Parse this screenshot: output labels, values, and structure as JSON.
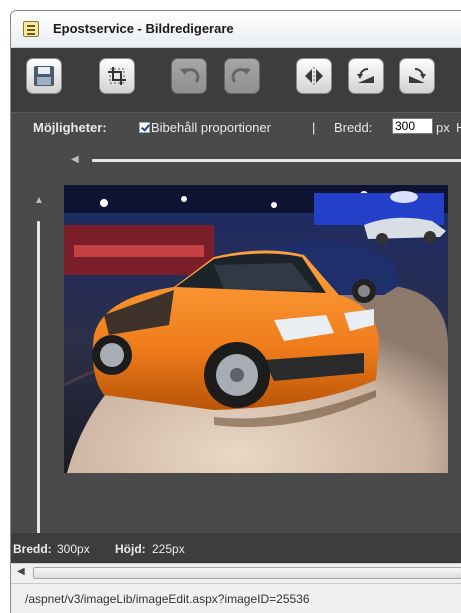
{
  "window": {
    "title": "Epostservice - Bildredigerare",
    "icon": "document-icon"
  },
  "toolbar": {
    "buttons": [
      {
        "name": "save-button",
        "icon": "floppy-disk-icon",
        "enabled": true
      },
      {
        "name": "crop-button",
        "icon": "crop-icon",
        "enabled": true
      },
      {
        "name": "undo-button",
        "icon": "undo-icon",
        "enabled": false
      },
      {
        "name": "redo-button",
        "icon": "redo-icon",
        "enabled": false
      },
      {
        "name": "flip-horizontal-button",
        "icon": "flip-horizontal-icon",
        "enabled": true
      },
      {
        "name": "rotate-left-button",
        "icon": "rotate-left-icon",
        "enabled": true
      },
      {
        "name": "rotate-right-button",
        "icon": "rotate-right-icon",
        "enabled": true
      }
    ]
  },
  "options": {
    "label": "Möjligheter:",
    "keep_proportions_label": "Bibehåll proportioner",
    "keep_proportions_checked": true,
    "separator": "|",
    "width_label": "Bredd:",
    "width_value": "300",
    "width_unit": "px",
    "height_label": "H"
  },
  "editor": {
    "image_description": "orange hatchback car at an auto show",
    "background": "#4a4a4a"
  },
  "footer": {
    "width_label": "Bredd:",
    "width_value": "300px",
    "height_label": "Höjd:",
    "height_value": "225px"
  },
  "statusbar": {
    "url": "/aspnet/v3/imageLib/imageEdit.aspx?imageID=25536"
  },
  "colors": {
    "toolbar": "#3d3d3d",
    "panel": "#4a4a4a",
    "car": "#f07d1c"
  }
}
